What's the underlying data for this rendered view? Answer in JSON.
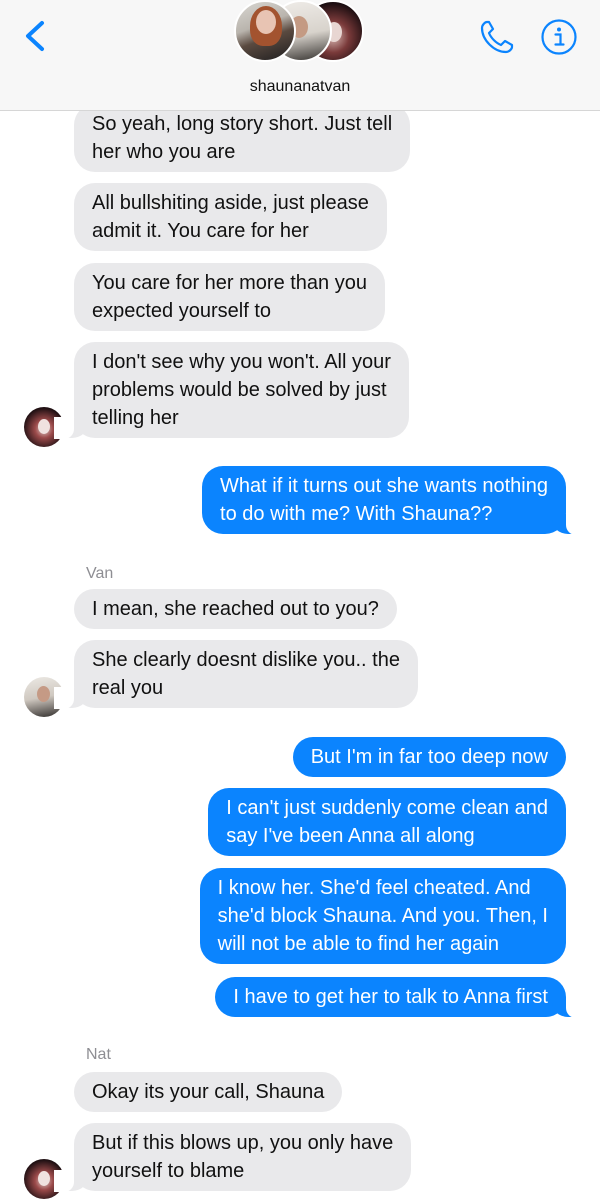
{
  "header": {
    "back_icon": "chevron-left-icon",
    "title": "shaunanatvan",
    "phone_icon": "phone-icon",
    "info_icon": "info-icon",
    "accent_color": "#0b84fe"
  },
  "thread": {
    "incoming_color": "#e9e9eb",
    "outgoing_color": "#0b84fe",
    "messages": [
      {
        "from": "Nat",
        "direction": "incoming",
        "text": "So yeah, long story short. Just tell\nher who you are"
      },
      {
        "from": "Nat",
        "direction": "incoming",
        "text": "All bullshiting aside, just please\nadmit it. You care for her"
      },
      {
        "from": "Nat",
        "direction": "incoming",
        "text": "You care for her more than you\nexpected yourself to"
      },
      {
        "from": "Nat",
        "direction": "incoming",
        "text": "I don't see why you won't. All your\nproblems would be solved by just\ntelling her"
      },
      {
        "from": "me",
        "direction": "outgoing",
        "text": "What if it turns out she wants nothing\nto do with me? With Shauna??"
      },
      {
        "from": "Van",
        "direction": "incoming",
        "sender_label": "Van",
        "text": "I mean, she reached out to you?"
      },
      {
        "from": "Van",
        "direction": "incoming",
        "text": "She clearly doesnt dislike you.. the\nreal you"
      },
      {
        "from": "me",
        "direction": "outgoing",
        "text": "But I'm in far too deep now"
      },
      {
        "from": "me",
        "direction": "outgoing",
        "text": "I can't just suddenly come clean and\nsay I've been Anna all along"
      },
      {
        "from": "me",
        "direction": "outgoing",
        "text": "I know her. She'd feel cheated. And\nshe'd block Shauna. And you. Then, I\nwill not be able to  find her again"
      },
      {
        "from": "me",
        "direction": "outgoing",
        "text": "I have to get her to talk to Anna first"
      },
      {
        "from": "Nat",
        "direction": "incoming",
        "sender_label": "Nat",
        "text": "Okay its your call, Shauna"
      },
      {
        "from": "Nat",
        "direction": "incoming",
        "text": "But if this blows up, you only have\nyourself to blame"
      }
    ]
  }
}
